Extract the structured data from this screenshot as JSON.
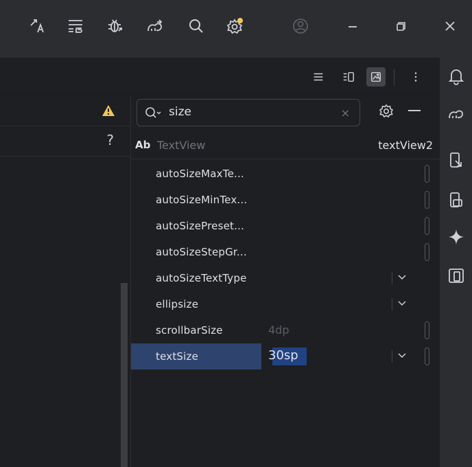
{
  "colors": {
    "accent": "#2e436e",
    "warning": "#f2c55c",
    "notification_dot": "#f2c55c"
  },
  "titlebar": {
    "icons": [
      "translate-icon",
      "change-list-icon",
      "debug-icon",
      "gradle-sync-icon",
      "search-icon",
      "settings-icon",
      "account-icon",
      "minimize-icon",
      "restore-icon",
      "close-icon"
    ]
  },
  "toolbar2": {
    "icons": [
      "code-view-icon",
      "split-view-icon",
      "design-view-icon",
      "more-options-icon"
    ]
  },
  "rightbar": {
    "icons": [
      "notifications-icon",
      "gradle-icon",
      "device-manager-icon",
      "running-devices-icon",
      "gemini-icon",
      "device-explorer-icon"
    ]
  },
  "leftpanel": {
    "help": "?"
  },
  "attributes_panel": {
    "search_value": "size",
    "clear": "×",
    "component": {
      "badge": "Ab",
      "type": "TextView",
      "id": "textView2"
    },
    "rows": [
      {
        "name": "autoSizeMaxTe...",
        "value": "",
        "control": "pill"
      },
      {
        "name": "autoSizeMinTex...",
        "value": "",
        "control": "pill"
      },
      {
        "name": "autoSizePreset...",
        "value": "",
        "control": "pill"
      },
      {
        "name": "autoSizeStepGr...",
        "value": "",
        "control": "pill"
      },
      {
        "name": "autoSizeTextType",
        "value": "",
        "control": "dropdown"
      },
      {
        "name": "ellipsize",
        "value": "",
        "control": "dropdown"
      },
      {
        "name": "scrollbarSize",
        "value": "4dp",
        "control": "pill"
      },
      {
        "name": "textSize",
        "value": "30sp",
        "control": "dropdown+pill",
        "selected": true
      }
    ]
  }
}
